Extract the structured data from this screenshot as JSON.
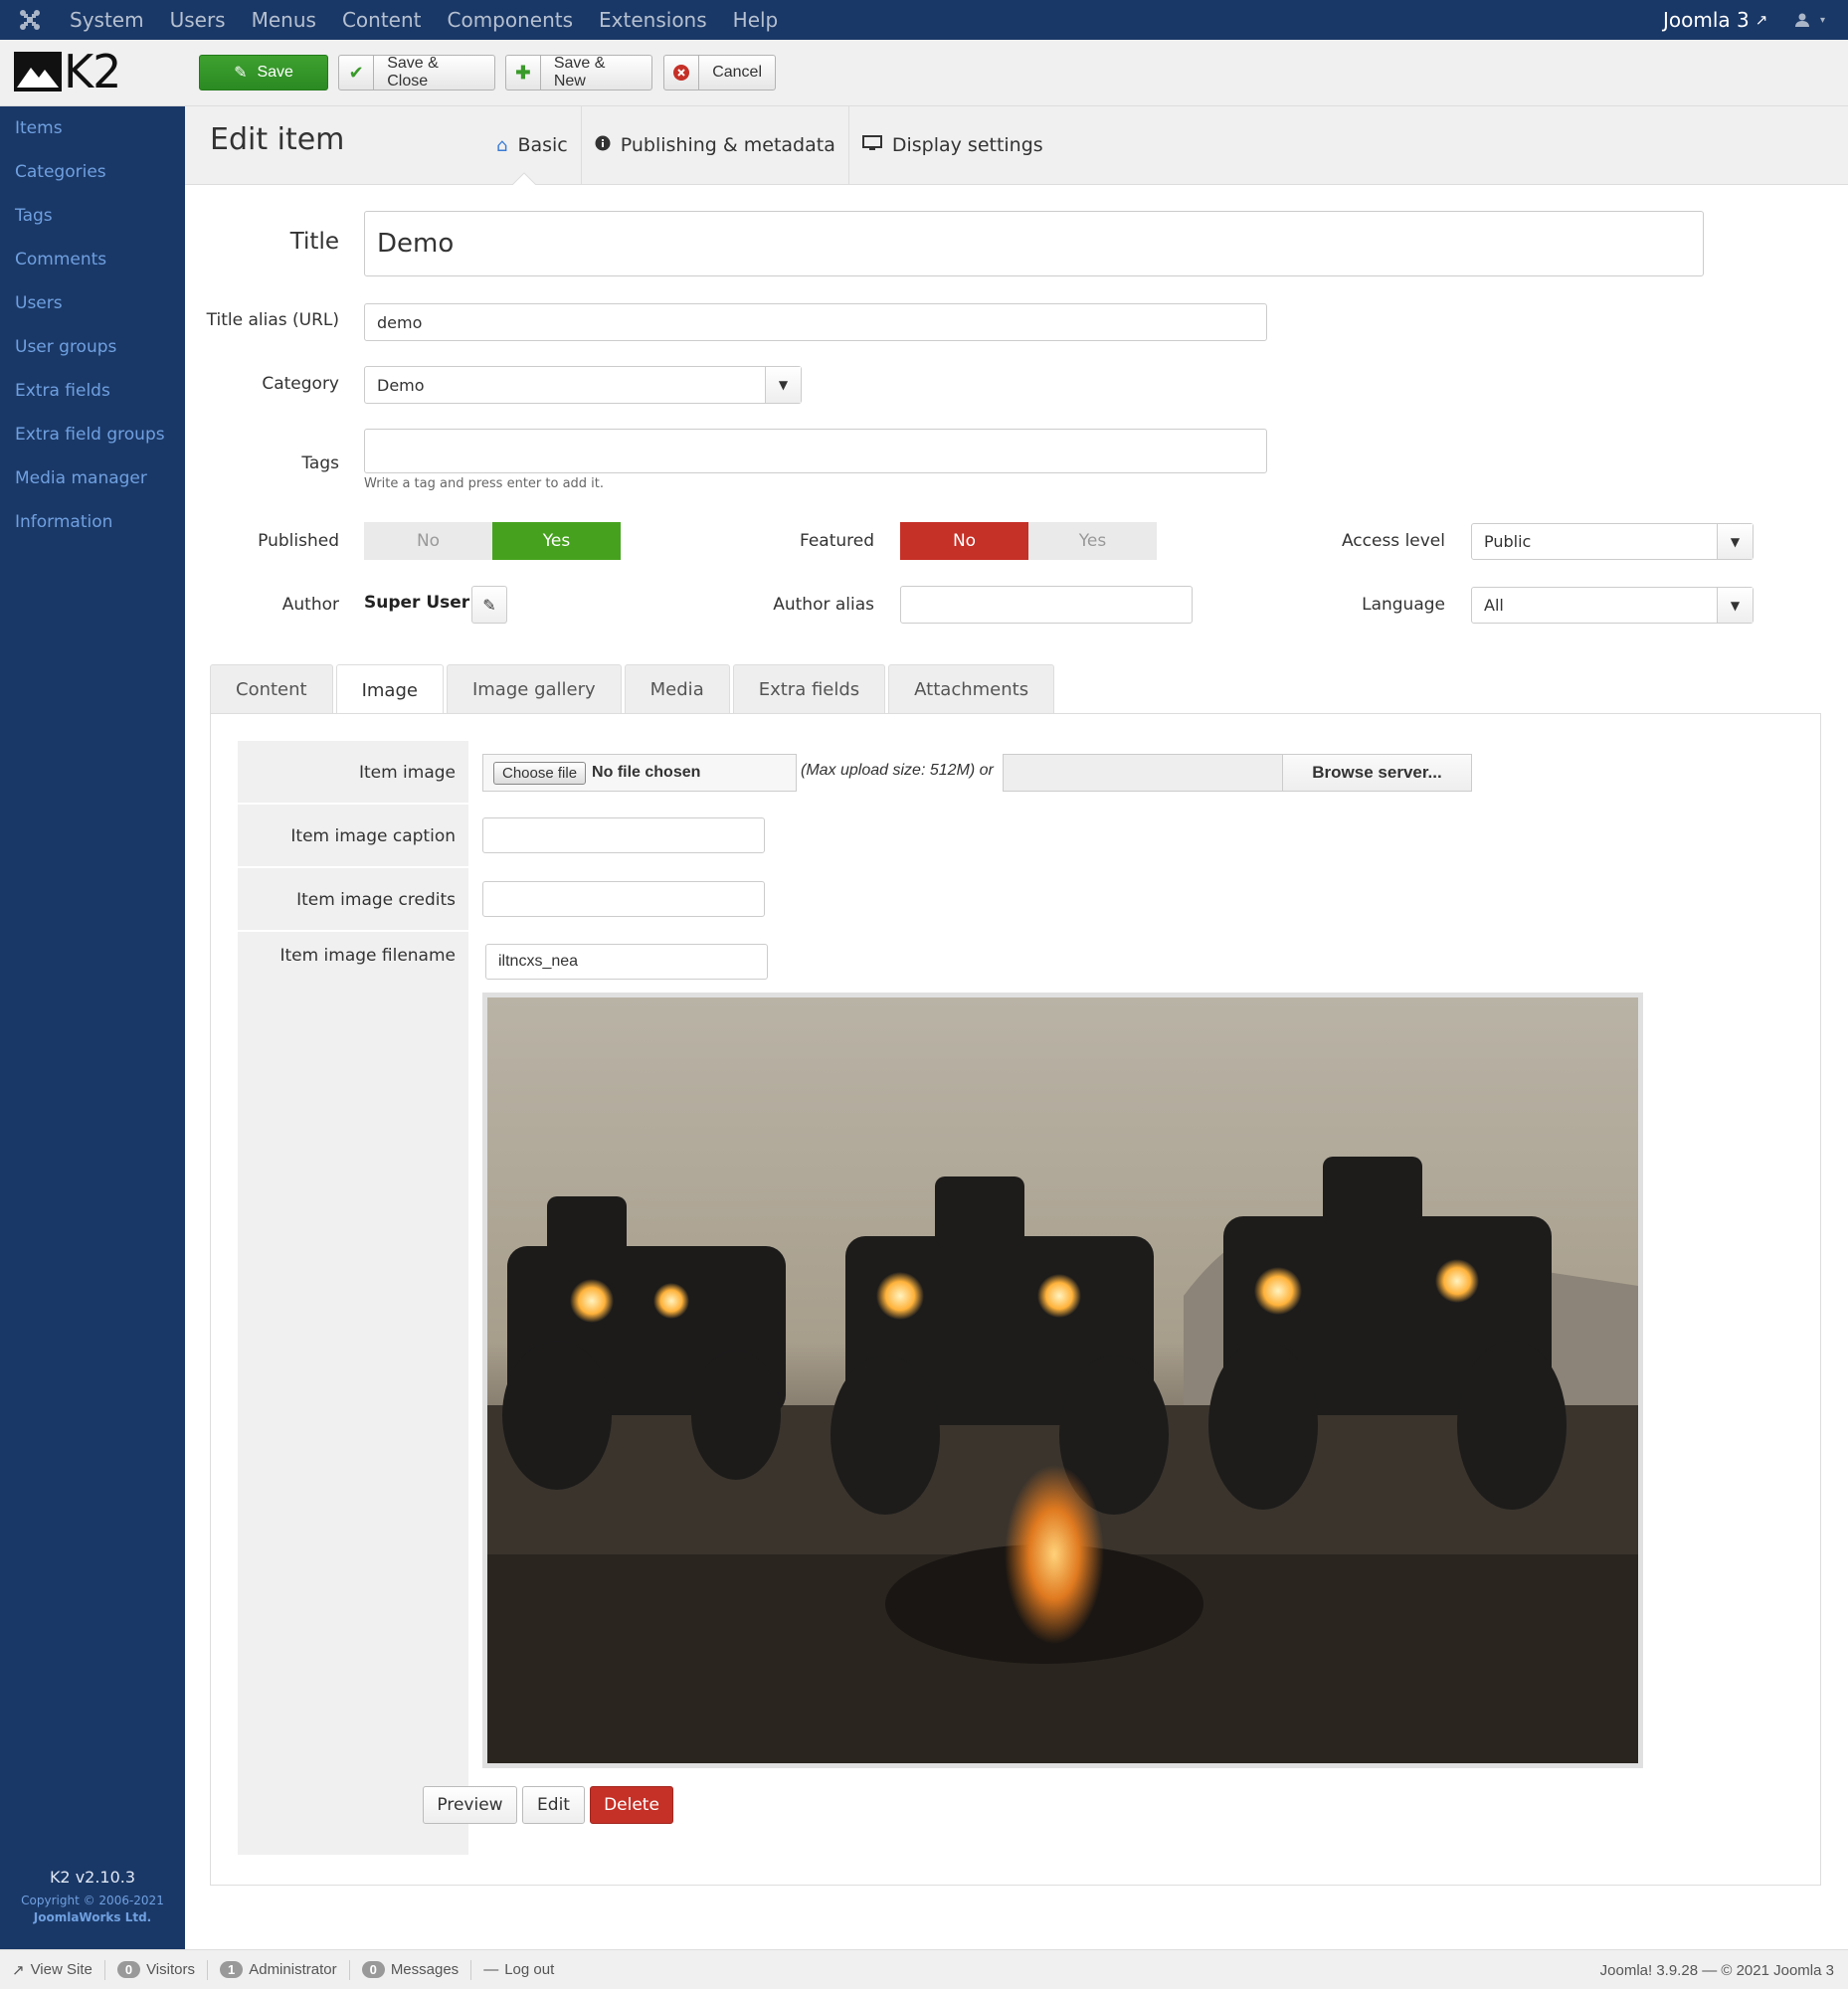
{
  "topbar": {
    "menu": [
      "System",
      "Users",
      "Menus",
      "Content",
      "Components",
      "Extensions",
      "Help"
    ],
    "site_link": "Joomla 3"
  },
  "toolbar": {
    "logo_text": "K2",
    "save_label": "Save",
    "save_close_label": "Save & Close",
    "save_new_label": "Save & New",
    "cancel_label": "Cancel",
    "colors": {
      "save": "#3ea12f",
      "cancel_icon": "#c53027"
    }
  },
  "sidebar": {
    "items": [
      "Items",
      "Categories",
      "Tags",
      "Comments",
      "Users",
      "User groups",
      "Extra fields",
      "Extra field groups",
      "Media manager",
      "Information"
    ],
    "version": "K2 v2.10.3",
    "copyright": "Copyright © 2006-2021",
    "company": "JoomlaWorks Ltd."
  },
  "header": {
    "title": "Edit item",
    "tabs": [
      {
        "label": "Basic",
        "icon": "home-icon",
        "active": true
      },
      {
        "label": "Publishing & metadata",
        "icon": "info-circle-icon",
        "active": false
      },
      {
        "label": "Display settings",
        "icon": "monitor-icon",
        "active": false
      }
    ]
  },
  "form": {
    "title_label": "Title",
    "title_value": "Demo",
    "alias_label": "Title alias (URL)",
    "alias_value": "demo",
    "category_label": "Category",
    "category_value": "Demo",
    "tags_label": "Tags",
    "tags_hint": "Write a tag and press enter to add it.",
    "published_label": "Published",
    "published_no": "No",
    "published_yes": "Yes",
    "published_value": "Yes",
    "featured_label": "Featured",
    "featured_no": "No",
    "featured_yes": "Yes",
    "featured_value": "No",
    "access_label": "Access level",
    "access_value": "Public",
    "author_label": "Author",
    "author_value": "Super User",
    "author_alias_label": "Author alias",
    "author_alias_value": "",
    "language_label": "Language",
    "language_value": "All"
  },
  "content_tabs": {
    "items": [
      "Content",
      "Image",
      "Image gallery",
      "Media",
      "Extra fields",
      "Attachments"
    ],
    "active": "Image"
  },
  "image_tab": {
    "item_image_label": "Item image",
    "choose_file": "Choose file",
    "no_file": "No file chosen",
    "max_upload": "(Max upload size: 512M) or",
    "browse_server": "Browse server...",
    "caption_label": "Item image caption",
    "caption_value": "",
    "credits_label": "Item image credits",
    "credits_value": "",
    "filename_label": "Item image filename",
    "filename_value": "iltncxs_nea",
    "preview_label": "Preview",
    "edit_label": "Edit",
    "delete_label": "Delete"
  },
  "footer": {
    "view_site": "View Site",
    "visitors_count": "0",
    "visitors": "Visitors",
    "admin_count": "1",
    "admin": "Administrator",
    "messages_count": "0",
    "messages": "Messages",
    "logout": "Log out",
    "version": "Joomla! 3.9.28  —  © 2021 Joomla 3"
  }
}
